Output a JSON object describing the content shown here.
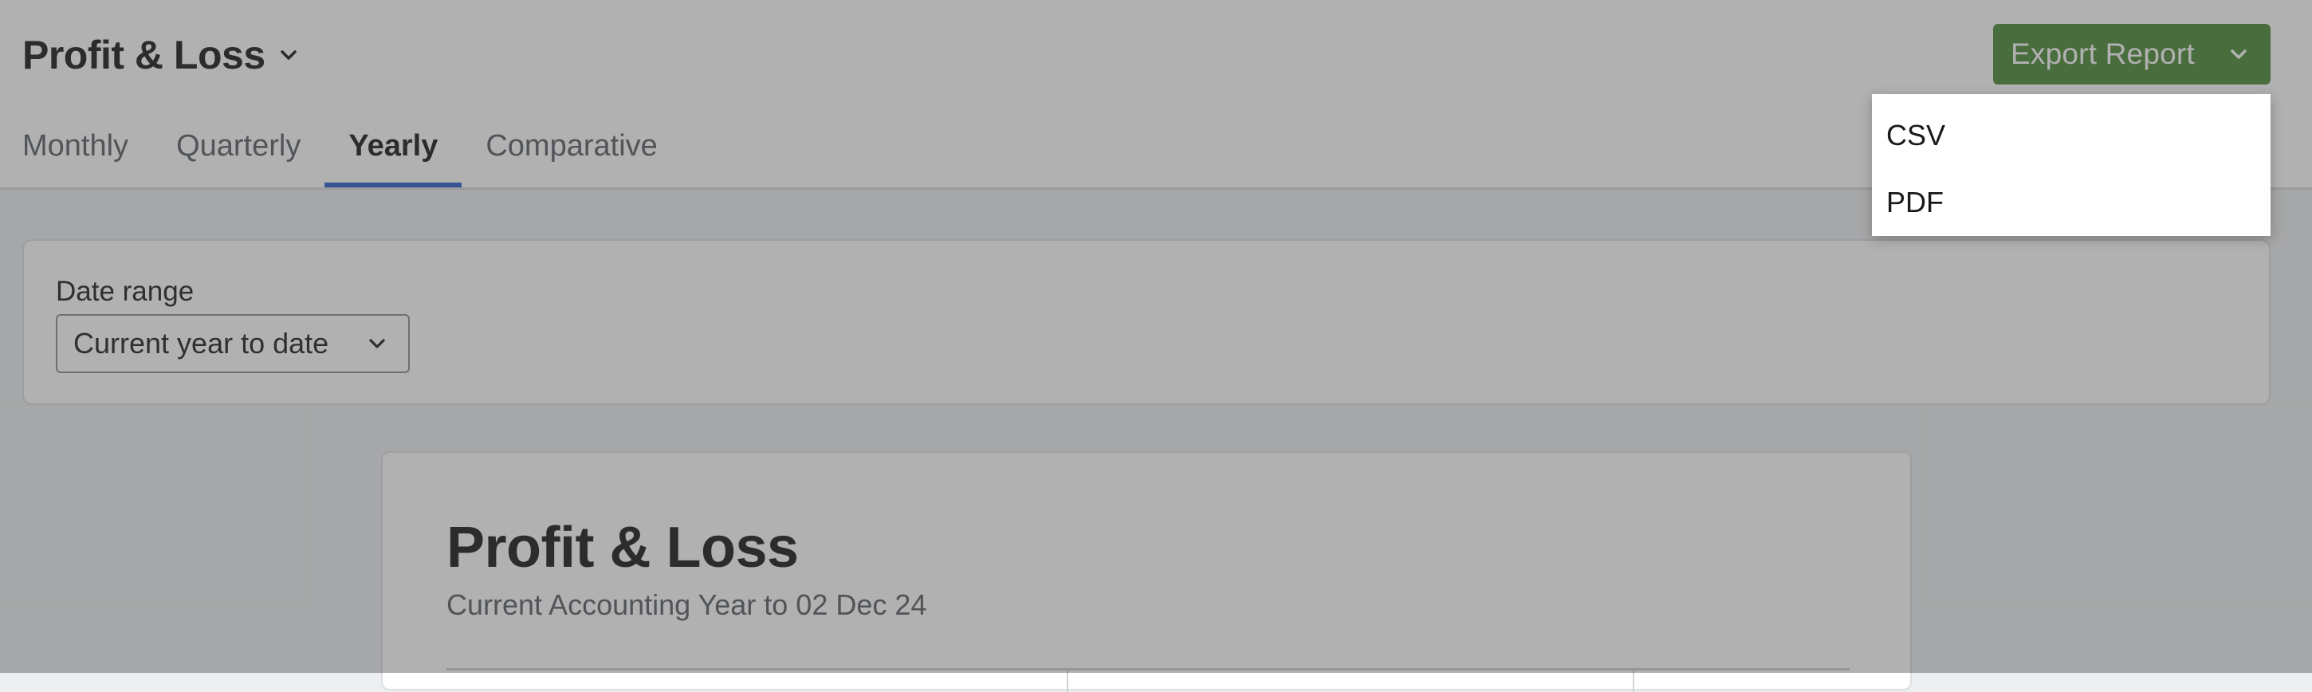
{
  "header": {
    "title": "Profit & Loss",
    "title_icon": "chevron-down-icon",
    "tabs": [
      {
        "label": "Monthly",
        "active": false
      },
      {
        "label": "Quarterly",
        "active": false
      },
      {
        "label": "Yearly",
        "active": true
      },
      {
        "label": "Comparative",
        "active": false
      }
    ],
    "export": {
      "label": "Export Report",
      "icon": "chevron-down-icon",
      "color": "#4e8b3a",
      "menu": [
        {
          "label": "CSV"
        },
        {
          "label": "PDF"
        }
      ]
    }
  },
  "filters": {
    "date_range_label": "Date range",
    "date_range_value": "Current year to date",
    "date_range_icon": "chevron-down-icon"
  },
  "report": {
    "title": "Profit & Loss",
    "subtitle": "Current Accounting Year to 02 Dec 24"
  },
  "colors": {
    "accent": "#2c5dcf",
    "overlay": "rgba(70,70,70,0.42)"
  }
}
